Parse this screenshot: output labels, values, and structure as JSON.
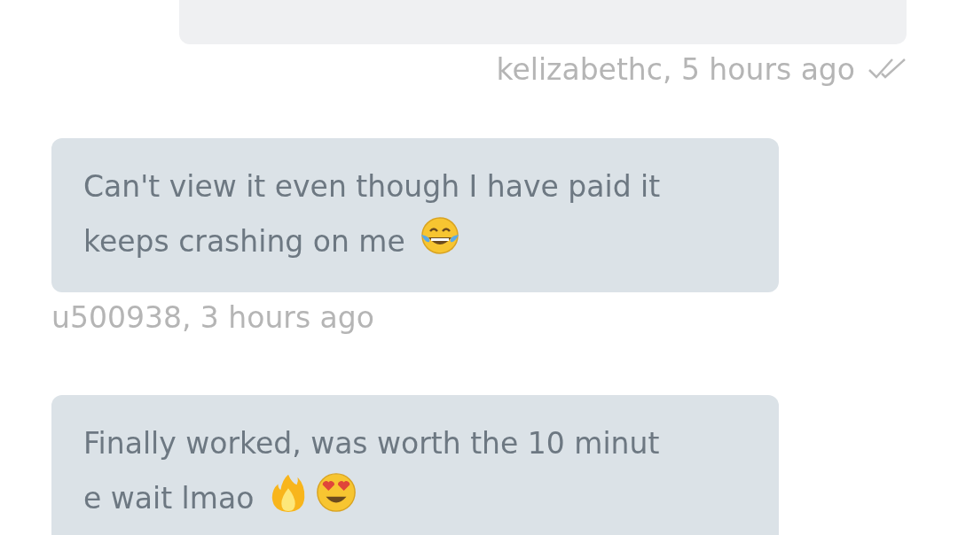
{
  "messages": [
    {
      "kind": "outgoing",
      "meta": "kelizabethc, 5 hours ago",
      "read": true
    },
    {
      "kind": "incoming",
      "lines": [
        "Can't view it even though I have paid it",
        "keeps crashing on me"
      ],
      "emoji": [
        {
          "kind": "laughing"
        }
      ],
      "meta": "u500938, 3 hours ago"
    },
    {
      "kind": "incoming",
      "lines": [
        "Finally worked, was worth the 10 minut",
        "e wait lmao"
      ],
      "emoji": [
        {
          "kind": "fire"
        },
        {
          "kind": "heart-eyes"
        }
      ]
    }
  ]
}
